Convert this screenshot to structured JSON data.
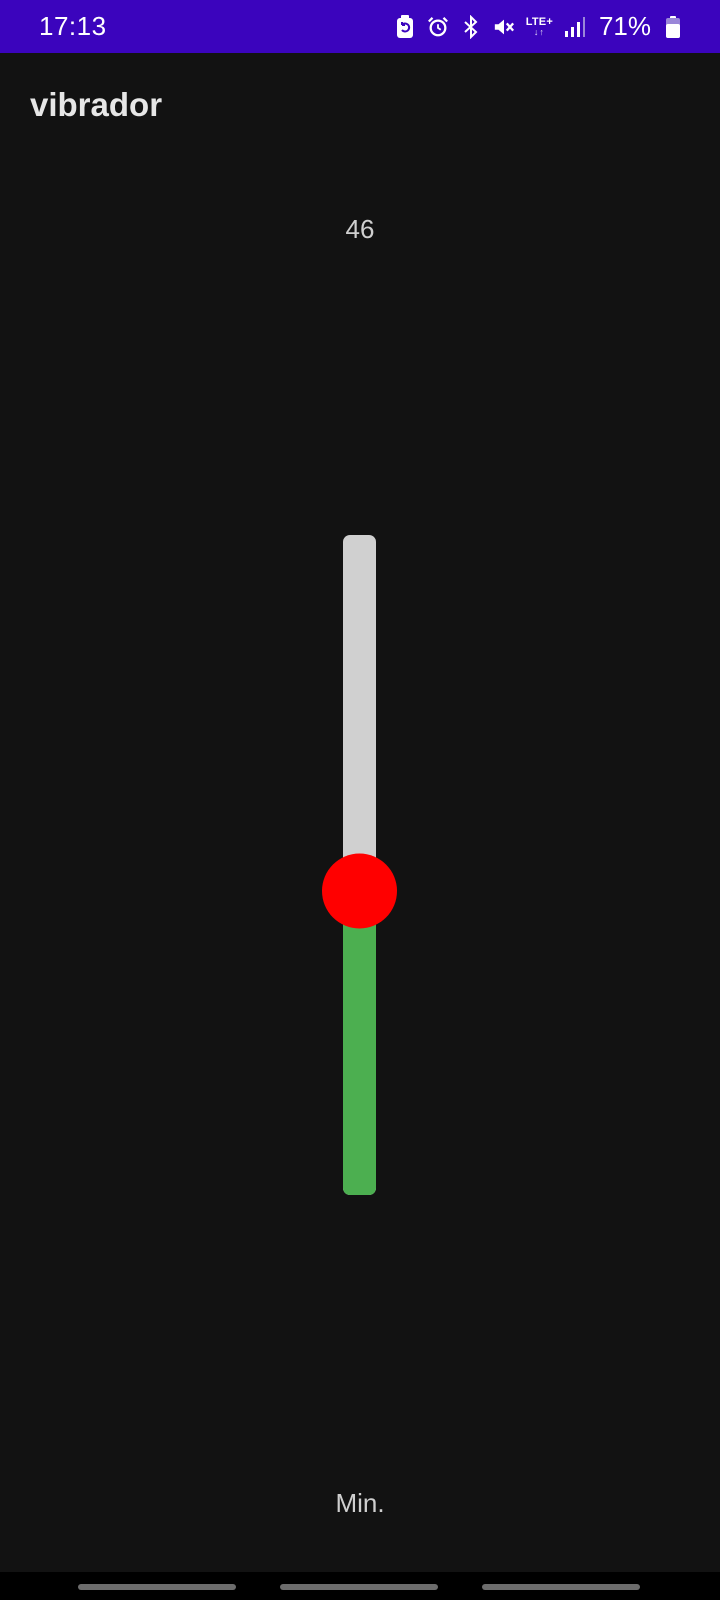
{
  "status_bar": {
    "time": "17:13",
    "network_label": "LTE+",
    "network_arrows": "↓↑",
    "battery_percent": "71%",
    "icons": [
      "battery-saver-icon",
      "alarm-icon",
      "bluetooth-icon",
      "vibrate-mute-icon",
      "lte-icon",
      "signal-icon",
      "battery-icon"
    ]
  },
  "app": {
    "title": "vibrador"
  },
  "slider": {
    "value_text": "46",
    "value": 46,
    "min": 0,
    "max": 100,
    "min_label": "Min.",
    "colors": {
      "track": "#d0d0d0",
      "fill": "#4caf50",
      "thumb": "#ff0000"
    }
  },
  "colors": {
    "status_bar": "#3b04bd",
    "background": "#121212"
  }
}
